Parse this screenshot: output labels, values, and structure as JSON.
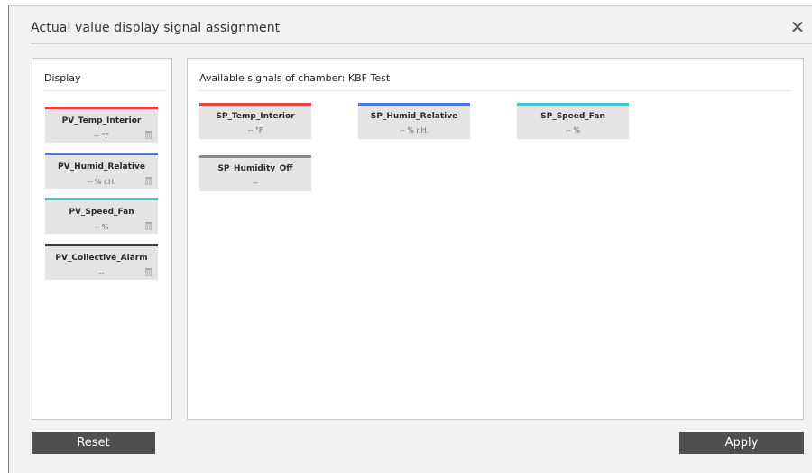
{
  "dialog": {
    "title": "Actual value display signal assignment",
    "close_icon": "close-icon"
  },
  "display_panel": {
    "heading": "Display",
    "items": [
      {
        "name": "PV_Temp_Interior",
        "value": "-- °F",
        "color": "#e8403c",
        "icon": "trash-icon"
      },
      {
        "name": "PV_Humid_Relative",
        "value": "-- % r.H.",
        "color": "#3f7de0",
        "icon": "trash-icon"
      },
      {
        "name": "PV_Speed_Fan",
        "value": "-- %",
        "color": "#3ec9c9",
        "icon": "trash-icon"
      },
      {
        "name": "PV_Collective_Alarm",
        "value": "--",
        "color": "#3a3a3a",
        "icon": "trash-icon"
      }
    ]
  },
  "signals_panel": {
    "heading": "Available signals of chamber: KBF Test",
    "items": [
      {
        "name": "SP_Temp_Interior",
        "value": "-- °F",
        "color": "#e8403c"
      },
      {
        "name": "SP_Humid_Relative",
        "value": "-- % r.H.",
        "color": "#3f7de0"
      },
      {
        "name": "SP_Speed_Fan",
        "value": "-- %",
        "color": "#3ec9c9"
      },
      {
        "name": "SP_Humidity_Off",
        "value": "--",
        "color": "#8a8a8a"
      }
    ]
  },
  "buttons": {
    "reset_label": "Reset",
    "apply_label": "Apply"
  }
}
